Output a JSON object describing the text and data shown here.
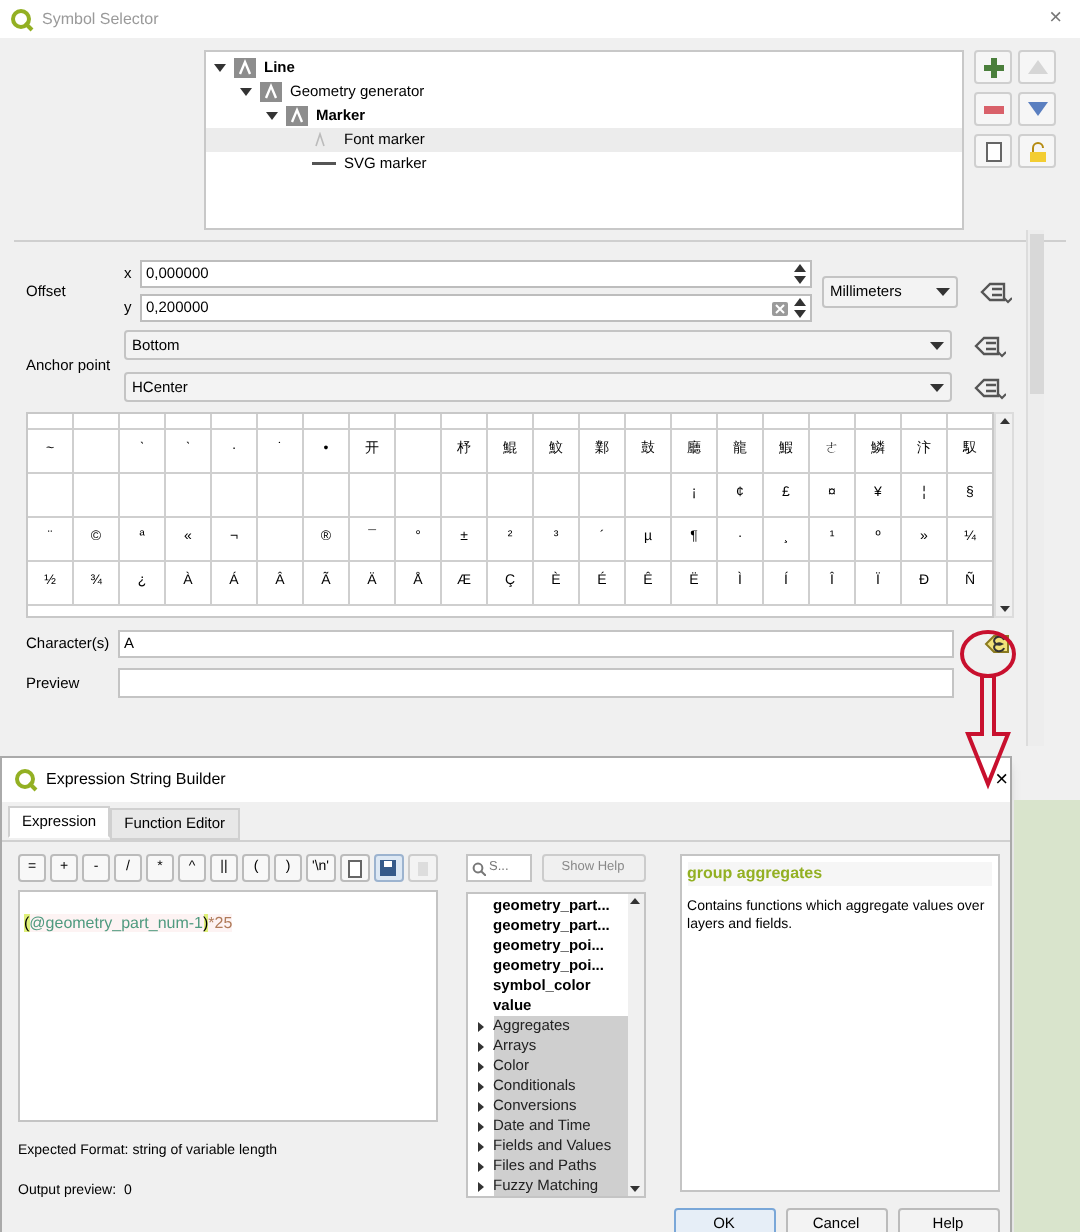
{
  "symbol_window": {
    "title": "Symbol Selector",
    "close": "×"
  },
  "tree": [
    {
      "label": "Line",
      "kind": "symbol",
      "expanded": true,
      "selected": false,
      "children": [
        {
          "label": "Geometry generator",
          "kind": "layer",
          "expanded": true,
          "selected": false,
          "children": [
            {
              "label": "Marker",
              "kind": "symbol",
              "expanded": true,
              "selected": false,
              "children": [
                {
                  "label": "Font marker",
                  "kind": "font",
                  "selected": true
                },
                {
                  "label": "SVG marker",
                  "kind": "svg",
                  "selected": false
                }
              ]
            }
          ]
        }
      ]
    }
  ],
  "offset": {
    "label": "Offset",
    "x_label": "x",
    "x_value": "0,000000",
    "y_label": "y",
    "y_value": "0,200000",
    "unit": "Millimeters"
  },
  "anchor": {
    "label": "Anchor point",
    "vertical": "Bottom",
    "horizontal": "HCenter"
  },
  "glyph_rows": [
    [
      null,
      null,
      null,
      null,
      null,
      null,
      null,
      null,
      null,
      null,
      null,
      null,
      null,
      null,
      null,
      null,
      null,
      null,
      null,
      null,
      null
    ],
    [
      "~",
      null,
      "ˋ",
      "ˋ",
      "·",
      "˙",
      "•",
      "开",
      null,
      "杼",
      "鯤",
      "魰",
      "鄴",
      "鼓",
      "廳",
      "龍",
      "鰕",
      "ㄜ",
      "鱗",
      "汴",
      "馭"
    ],
    [
      null,
      null,
      null,
      null,
      null,
      null,
      null,
      null,
      null,
      null,
      null,
      null,
      null,
      null,
      "¡",
      "¢",
      "£",
      "¤",
      "¥",
      "¦",
      "§"
    ],
    [
      "¨",
      "©",
      "ª",
      "«",
      "¬",
      null,
      "®",
      "¯",
      "°",
      "±",
      "²",
      "³",
      "´",
      "µ",
      "¶",
      "·",
      "¸",
      "¹",
      "º",
      "»",
      "¼"
    ],
    [
      "½",
      "¾",
      "¿",
      "À",
      "Á",
      "Â",
      "Ã",
      "Ä",
      "Å",
      "Æ",
      "Ç",
      "È",
      "É",
      "Ê",
      "Ë",
      "Ì",
      "Í",
      "Î",
      "Ï",
      "Ð",
      "Ñ"
    ]
  ],
  "characters": {
    "label": "Character(s)",
    "value": "A"
  },
  "preview": {
    "label": "Preview"
  },
  "expression_dialog": {
    "title": "Expression String Builder",
    "close": "×",
    "tabs": [
      {
        "label": "Expression",
        "selected": true
      },
      {
        "label": "Function Editor",
        "selected": false
      }
    ],
    "operators": [
      "=",
      "+",
      "-",
      "/",
      "*",
      "^",
      "||",
      "(",
      ")",
      "'\\n'"
    ],
    "expression": [
      {
        "text": "(",
        "kind": "bracket"
      },
      {
        "text": "@geometry_part_num-1",
        "kind": "variable"
      },
      {
        "text": ")",
        "kind": "bracket"
      },
      {
        "text": "*25",
        "kind": "number"
      }
    ],
    "expected_format": "Expected Format: string of variable length",
    "output_label": "Output preview:",
    "output_value": "0",
    "search_placeholder": "S...",
    "show_help": "Show Help",
    "functions": [
      {
        "label": "geometry_part...",
        "kind": "variable"
      },
      {
        "label": "geometry_part...",
        "kind": "variable"
      },
      {
        "label": "geometry_poi...",
        "kind": "variable"
      },
      {
        "label": "geometry_poi...",
        "kind": "variable"
      },
      {
        "label": "symbol_color",
        "kind": "variable"
      },
      {
        "label": "value",
        "kind": "variable"
      },
      {
        "label": "Aggregates",
        "kind": "group"
      },
      {
        "label": "Arrays",
        "kind": "group"
      },
      {
        "label": "Color",
        "kind": "group"
      },
      {
        "label": "Conditionals",
        "kind": "group"
      },
      {
        "label": "Conversions",
        "kind": "group"
      },
      {
        "label": "Date and Time",
        "kind": "group"
      },
      {
        "label": "Fields and Values",
        "kind": "group"
      },
      {
        "label": "Files and Paths",
        "kind": "group"
      },
      {
        "label": "Fuzzy Matching",
        "kind": "group"
      }
    ],
    "help_title": "group aggregates",
    "help_text": "Contains functions which aggregate values over layers and fields.",
    "buttons": [
      "OK",
      "Cancel",
      "Help"
    ]
  }
}
